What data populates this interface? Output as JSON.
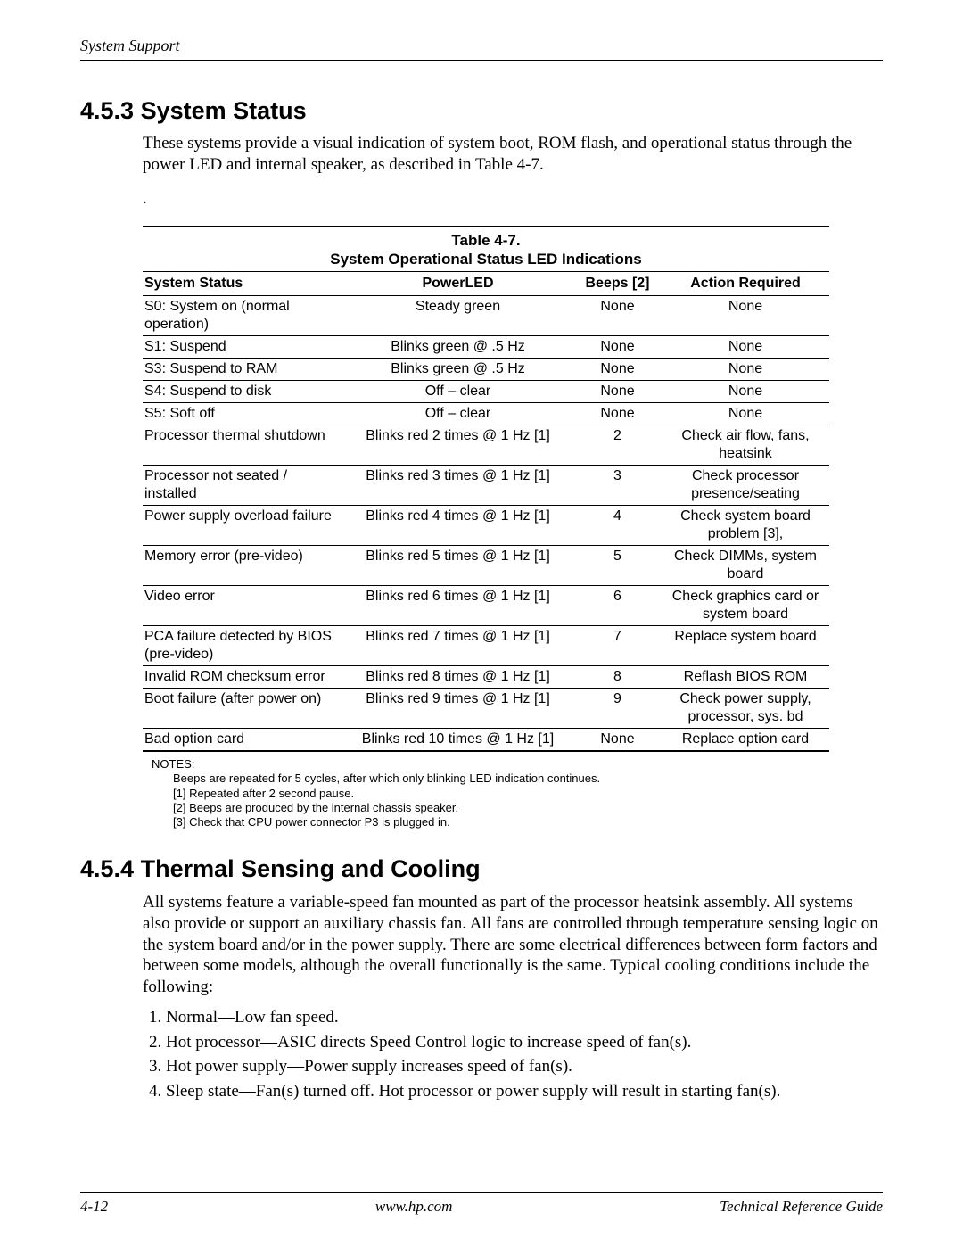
{
  "header": {
    "running": "System Support"
  },
  "section1": {
    "number": "4.5.3",
    "title": "System Status",
    "para": "These systems provide a visual indication of system boot, ROM flash, and operational status through the power LED and internal speaker, as described in Table 4-7.",
    "dot": "."
  },
  "table": {
    "caption": "Table 4-7.",
    "subcaption": "System Operational Status LED Indications",
    "headers": [
      "System Status",
      "PowerLED",
      "Beeps [2]",
      "Action Required"
    ],
    "rows": [
      [
        "S0: System on (normal operation)",
        "Steady green",
        "None",
        "None"
      ],
      [
        "S1: Suspend",
        "Blinks green @ .5 Hz",
        "None",
        "None"
      ],
      [
        "S3: Suspend to RAM",
        "Blinks green @ .5 Hz",
        "None",
        "None"
      ],
      [
        "S4: Suspend to disk",
        "Off – clear",
        "None",
        "None"
      ],
      [
        "S5: Soft off",
        "Off – clear",
        "None",
        "None"
      ],
      [
        "Processor thermal shutdown",
        "Blinks red 2 times @ 1 Hz [1]",
        "2",
        "Check air flow, fans, heatsink"
      ],
      [
        "Processor not seated / installed",
        "Blinks red 3 times @ 1 Hz [1]",
        "3",
        "Check processor presence/seating"
      ],
      [
        "Power supply overload failure",
        "Blinks red 4 times @ 1 Hz [1]",
        "4",
        "Check system board problem [3],"
      ],
      [
        "Memory error (pre-video)",
        "Blinks red 5 times @ 1 Hz [1]",
        "5",
        "Check DIMMs, system board"
      ],
      [
        "Video error",
        "Blinks red 6 times @ 1 Hz [1]",
        "6",
        "Check graphics card or system board"
      ],
      [
        "PCA failure detected by BIOS (pre-video)",
        "Blinks red 7 times @ 1 Hz [1]",
        "7",
        "Replace system board"
      ],
      [
        "Invalid ROM checksum error",
        "Blinks red 8 times @ 1 Hz [1]",
        "8",
        "Reflash BIOS ROM"
      ],
      [
        "Boot failure (after power on)",
        "Blinks red 9 times @ 1 Hz [1]",
        "9",
        "Check power supply, processor, sys. bd"
      ],
      [
        "Bad option card",
        "Blinks red 10 times @ 1 Hz [1]",
        "None",
        "Replace option card"
      ]
    ]
  },
  "notes": {
    "heading": "NOTES:",
    "items": [
      "Beeps are repeated for 5 cycles, after which only blinking LED indication continues.",
      "[1] Repeated after 2 second pause.",
      "[2] Beeps are produced by the internal chassis speaker.",
      "[3] Check that CPU power connector P3 is plugged in."
    ]
  },
  "section2": {
    "number": "4.5.4",
    "title": "Thermal Sensing and Cooling",
    "para": "All systems feature a variable-speed fan mounted as part of the processor heatsink assembly. All systems also provide or support an auxiliary chassis fan. All fans are controlled through temperature sensing logic on the system board and/or in the power supply. There are some electrical differences between form factors and between some models, although the overall functionally is the same. Typical cooling conditions include the following:",
    "list": [
      "Normal—Low fan speed.",
      "Hot processor—ASIC directs Speed Control logic to increase speed of fan(s).",
      "Hot power supply—Power supply increases speed of fan(s).",
      "Sleep state—Fan(s) turned off. Hot processor or power supply will result in starting fan(s)."
    ]
  },
  "footer": {
    "left": "4-12",
    "center": "www.hp.com",
    "right": "Technical Reference Guide"
  }
}
